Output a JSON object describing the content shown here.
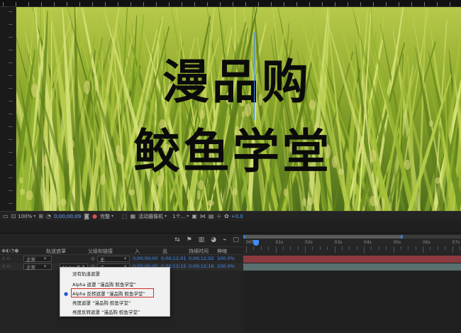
{
  "composition": {
    "title_line1": "漫品购",
    "title_line2": "鲛鱼学堂"
  },
  "viewer_toolbar": {
    "zoom": "100%",
    "timecode": "0;00;00;09",
    "resolution": "完整",
    "camera": "活动摄像机",
    "views": "1个...",
    "exposure": "+0.0"
  },
  "timeline": {
    "ruler_labels": [
      "00f",
      "01s",
      "02s",
      "03s",
      "04s",
      "05s",
      "06s",
      "07s"
    ],
    "columns": {
      "trackmatte": "轨道遮罩",
      "parent": "父级和链接",
      "in": "入",
      "out": "出",
      "duration": "持续时间",
      "stretch": "伸缩"
    },
    "layers": [
      {
        "mode": "正常",
        "matte": "",
        "parent": "无",
        "in": "0;00;00;00",
        "out": "0;00;12;01",
        "duration": "0;00;12;02",
        "stretch": "100.0%"
      },
      {
        "mode": "正常",
        "matte": "Alpha 反",
        "parent": "无",
        "in": "0;00;00;00",
        "out": "0;00;12;15",
        "duration": "0;00;12;16",
        "stretch": "100.0%"
      }
    ]
  },
  "matte_menu": {
    "items": [
      "没有轨道遮罩",
      "Alpha 遮罩 “漫品购 鲛鱼学堂”",
      "Alpha 反转遮罩 “漫品购 鲛鱼学堂”",
      "亮度遮罩 “漫品购 鲛鱼学堂”",
      "亮度反转遮罩 “漫品购 鲛鱼学堂”"
    ],
    "selected_index": 2
  },
  "colors": {
    "accent": "#3f8cff",
    "track_red": "#8c3a3f",
    "track_teal": "#5a6f6f",
    "highlight": "#d23030"
  }
}
